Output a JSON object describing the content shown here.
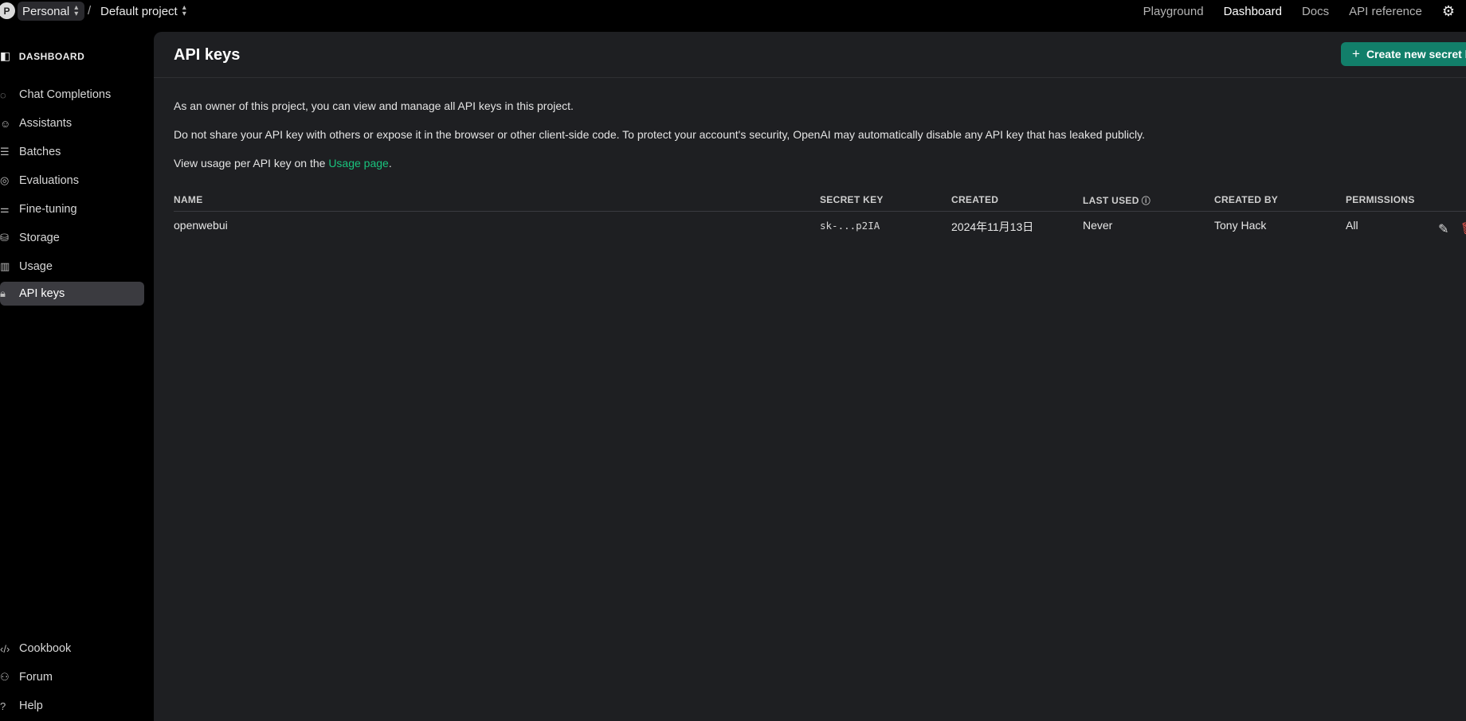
{
  "topbar": {
    "avatar_letter": "P",
    "org": "Personal",
    "separator": "/",
    "project": "Default project",
    "nav": [
      "Playground",
      "Dashboard",
      "Docs",
      "API reference"
    ],
    "active_nav": "Dashboard"
  },
  "sidebar": {
    "header": "DASHBOARD",
    "items": [
      {
        "label": "Chat Completions",
        "icon": "chat-bubble-icon"
      },
      {
        "label": "Assistants",
        "icon": "robot-icon"
      },
      {
        "label": "Batches",
        "icon": "batches-icon"
      },
      {
        "label": "Evaluations",
        "icon": "compass-icon"
      },
      {
        "label": "Fine-tuning",
        "icon": "sliders-icon"
      },
      {
        "label": "Storage",
        "icon": "database-icon"
      },
      {
        "label": "Usage",
        "icon": "bar-chart-icon"
      },
      {
        "label": "API keys",
        "icon": "lock-icon"
      }
    ],
    "active_item": "API keys",
    "footer": [
      {
        "label": "Cookbook",
        "icon": "code-icon"
      },
      {
        "label": "Forum",
        "icon": "people-icon"
      },
      {
        "label": "Help",
        "icon": "help-icon"
      }
    ]
  },
  "main": {
    "title": "API keys",
    "create_button": "Create new secret key",
    "para1": "As an owner of this project, you can view and manage all API keys in this project.",
    "para2": "Do not share your API key with others or expose it in the browser or other client-side code. To protect your account's security, OpenAI may automatically disable any API key that has leaked publicly.",
    "para3_prefix": "View usage per API key on the ",
    "para3_link": "Usage page",
    "para3_suffix": ".",
    "table": {
      "columns": [
        "NAME",
        "SECRET KEY",
        "CREATED",
        "LAST USED",
        "CREATED BY",
        "PERMISSIONS"
      ],
      "rows": [
        {
          "name": "openwebui",
          "secret": "sk-...p2IA",
          "created": "2024年11月13日",
          "last_used": "Never",
          "created_by": "Tony Hack",
          "permissions": "All"
        }
      ]
    }
  },
  "colors": {
    "accent": "#127f6a",
    "link": "#19c37d",
    "danger": "#e5534b",
    "panel": "#1e1f22"
  }
}
